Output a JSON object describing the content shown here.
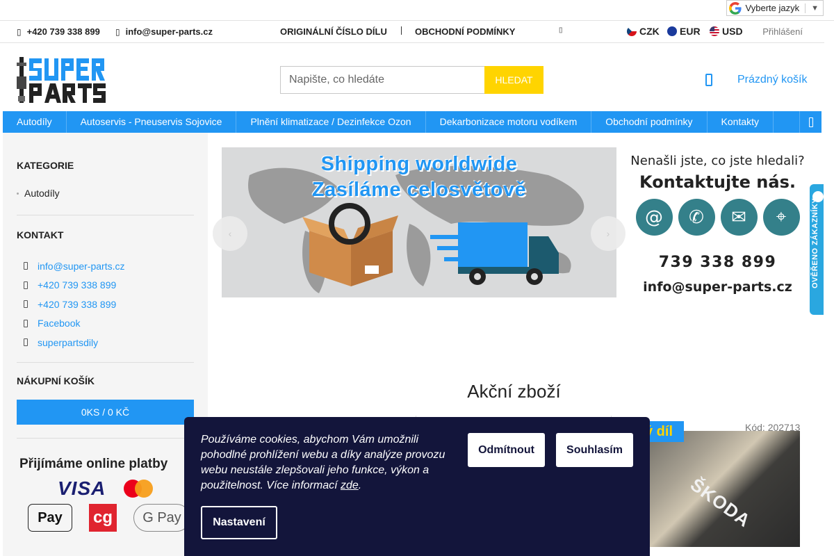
{
  "translate": {
    "label": "Vyberte jazyk",
    "caret": "▼"
  },
  "topbar": {
    "phone": "+420 739 338 899",
    "email": "info@super-parts.cz",
    "links": [
      "ORIGINÁLNÍ ČÍSLO DÍLU",
      "OBCHODNÍ PODMÍNKY"
    ],
    "currencies": [
      "CZK",
      "EUR",
      "USD"
    ],
    "login": "Přihlášení"
  },
  "header": {
    "search_placeholder": "Napište, co hledáte",
    "search_button": "HLEDAT",
    "cart_label": "Prázdný košík"
  },
  "nav": {
    "items": [
      "Autodíly",
      "Autoservis - Pneuservis Sojovice",
      "Plnění klimatizace / Dezinfekce Ozon",
      "Dekarbonizace motoru vodíkem",
      "Obchodní podmínky",
      "Kontakty"
    ]
  },
  "sidebar": {
    "categories_title": "KATEGORIE",
    "categories": [
      "Autodíly"
    ],
    "contact_title": "KONTAKT",
    "contacts": [
      "info@super-parts.cz",
      "+420 739 338 899",
      "+420 739 338 899",
      "Facebook",
      "superpartsdily"
    ],
    "cart_title": "NÁKUPNÍ KOŠÍK",
    "cart_summary": "0KS / 0 KČ",
    "payments_title": "Přijímáme online platby",
    "payment_methods": [
      "VISA",
      "Pay",
      "cg",
      "G Pay"
    ]
  },
  "banner": {
    "line1": "Shipping worldwide",
    "line2": "Zasíláme celosvětově"
  },
  "contact_panel": {
    "question": "Nenašli jste, co jste hledali?",
    "heading": "Kontaktujte nás.",
    "phone": "739 338 899",
    "email": "info@super-parts.cz"
  },
  "main": {
    "section_title": "Akční zboží",
    "product_code": "Kód: 202713",
    "product_badge": "ý díl",
    "product_watermark": "ŠKODA"
  },
  "verified_badge": "OVĚŘENO ZÁKAZNÍKY",
  "cookie": {
    "text": "Používáme cookies, abychom Vám umožnili pohodlné prohlížení webu a díky analýze provozu webu neustále zlepšovali jeho funkce, výkon a použitelnost. Více informací",
    "link": "zde",
    "reject": "Odmítnout",
    "accept": "Souhlasím",
    "settings": "Nastavení"
  },
  "colors": {
    "accent": "#2196f3",
    "search_button": "#ffd400",
    "cookie_bg": "#13153b",
    "sidebar_bg": "#f5f5f5"
  }
}
